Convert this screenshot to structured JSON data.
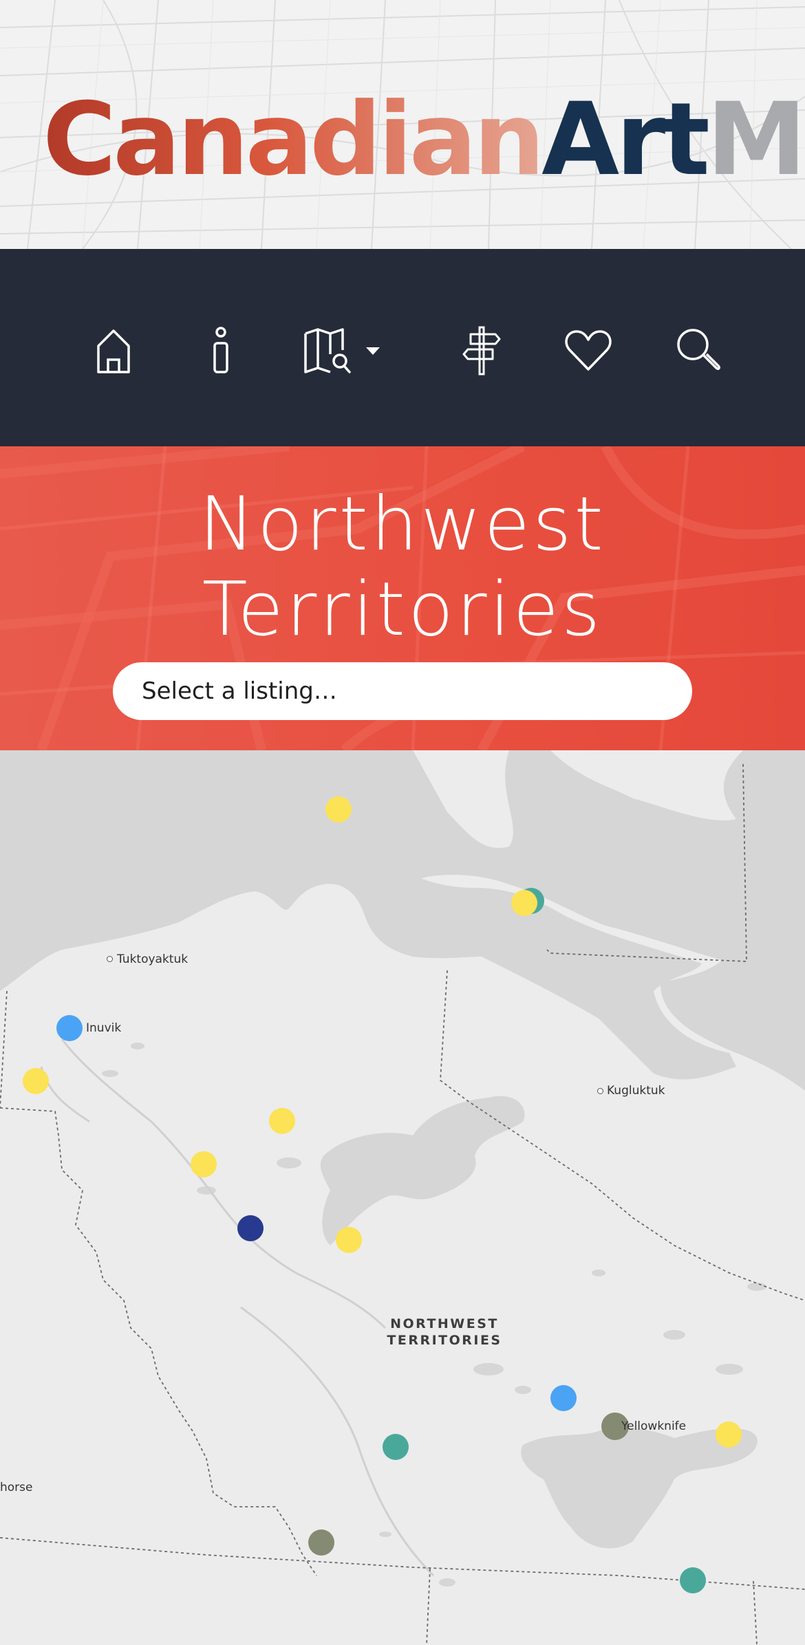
{
  "brand": {
    "part1": "Canadian",
    "part2": "Art",
    "part3": "Map",
    "colors": {
      "canadian_start": "#b23a28",
      "canadian_end": "#e5a592",
      "art": "#173251",
      "map": "#a9aaad"
    }
  },
  "nav": {
    "background": "#252b38",
    "items": [
      {
        "icon": "home-icon"
      },
      {
        "icon": "info-icon"
      },
      {
        "icon": "map-search-icon",
        "has_dropdown": true
      },
      {
        "icon": "signpost-icon"
      },
      {
        "icon": "heart-icon"
      },
      {
        "icon": "search-icon"
      }
    ]
  },
  "hero": {
    "title_line1": "Northwest",
    "title_line2": "Territories",
    "select_placeholder": "Select a listing…",
    "background": "#e84f3f"
  },
  "map": {
    "places": {
      "tuktoyaktuk": "Tuktoyaktuk",
      "inuvik": "Inuvik",
      "kugluktuk": "Kugluktuk",
      "yellowknife": "Yellowknife",
      "whitehorse": "horse"
    },
    "region_line1": "NORTHWEST",
    "region_line2": "TERRITORIES",
    "marker_colors": {
      "yellow": "#fce255",
      "teal": "#4aa89b",
      "light_blue": "#4aa3f4",
      "navy": "#283a8f",
      "olive": "#858a72"
    }
  }
}
